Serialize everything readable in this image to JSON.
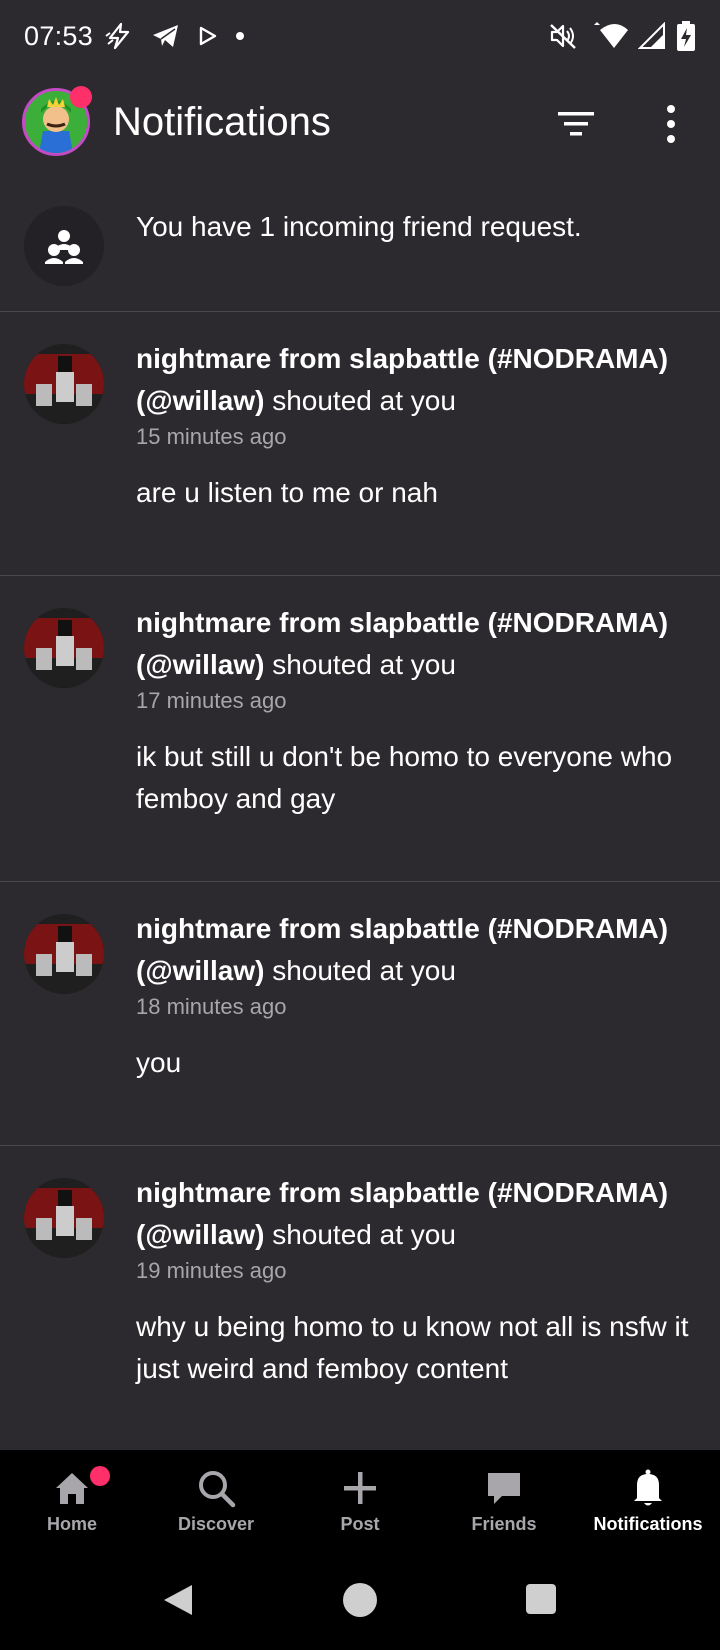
{
  "status_bar": {
    "time": "07:53",
    "left_icons": [
      "lightning-icon",
      "telegram-icon",
      "play-store-icon",
      "dot-icon"
    ],
    "right_icons": [
      "mute-icon",
      "wifi-icon",
      "signal-icon",
      "battery-charging-icon"
    ]
  },
  "app_bar": {
    "title": "Notifications",
    "has_notification_dot": true
  },
  "friend_request": {
    "text": "You have 1 incoming friend request."
  },
  "notifications": [
    {
      "user": "nightmare from slapbattle (#NODRAMA) (@willaw)",
      "action": "shouted at you",
      "time": "15 minutes ago",
      "message": "are u listen to me or nah"
    },
    {
      "user": "nightmare from slapbattle (#NODRAMA) (@willaw)",
      "action": "shouted at you",
      "time": "17 minutes ago",
      "message": "ik but still u don't be homo to everyone who femboy and gay"
    },
    {
      "user": "nightmare from slapbattle (#NODRAMA) (@willaw)",
      "action": "shouted at you",
      "time": "18 minutes ago",
      "message": "you"
    },
    {
      "user": "nightmare from slapbattle (#NODRAMA) (@willaw)",
      "action": "shouted at you",
      "time": "19 minutes ago",
      "message": "why u being homo to u know not all is nsfw it just weird and femboy content"
    }
  ],
  "bottom_nav": {
    "items": [
      {
        "label": "Home",
        "icon": "home-icon"
      },
      {
        "label": "Discover",
        "icon": "search-icon"
      },
      {
        "label": "Post",
        "icon": "plus-icon"
      },
      {
        "label": "Friends",
        "icon": "chat-icon"
      },
      {
        "label": "Notifications",
        "icon": "bell-icon"
      }
    ],
    "active": "Notifications"
  },
  "colors": {
    "background": "#2c2a2e",
    "accent_dot": "#ff2f6a",
    "nav_background": "#000000",
    "muted_text": "#a8a6ab"
  }
}
